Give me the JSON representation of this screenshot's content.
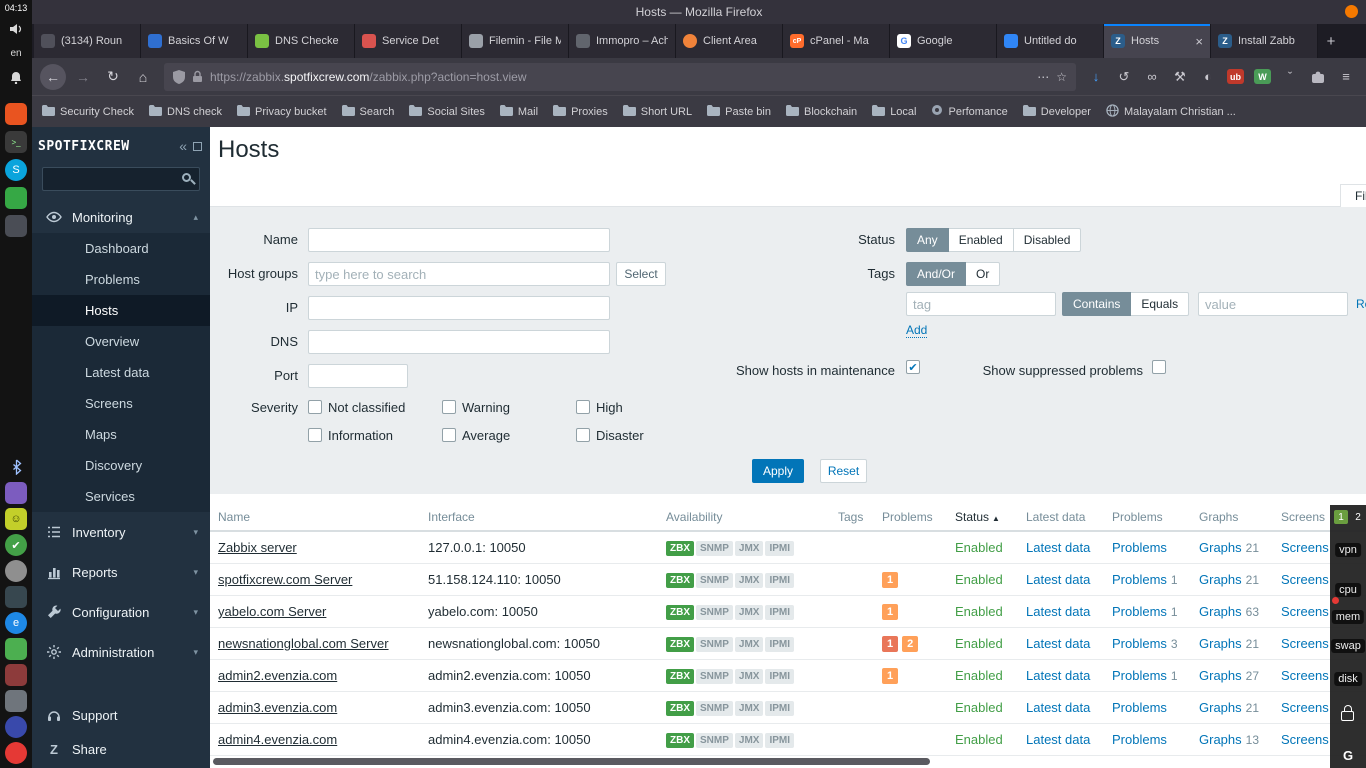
{
  "icons": {
    "back": "←",
    "forward": "→",
    "reload": "↻",
    "home": "⌂",
    "overflow": "⋯",
    "star": "☆",
    "download": "↓",
    "history": "↺",
    "infinity": "∞",
    "wrench": "⚒",
    "moon": "◐",
    "chevron_down": "ˇ",
    "menu": "≡",
    "new_tab": "+",
    "close": "×",
    "collapse": "«",
    "sort_asc": "▲",
    "chevron_expanded": "▴",
    "chevron_collapsed": "▾",
    "check": "✔"
  },
  "colors": {
    "accent_blue": "#0275b8",
    "status_green": "#429e47",
    "severity_average": "#ffa059",
    "severity_high": "#e97659",
    "segment_selected": "#768d99"
  },
  "os_panel": {
    "time": "04:13",
    "keyboard_layout": "en",
    "app_icons": [
      {
        "name": "orange-app-icon",
        "color": "#e95420",
        "glyph": "",
        "shape": "square"
      },
      {
        "name": "terminal-app-icon",
        "color": "#3a3a3a",
        "glyph": ">_",
        "shape": "square"
      },
      {
        "name": "skype-app-icon",
        "color": "#0aa4dc",
        "glyph": "S",
        "shape": "circle"
      },
      {
        "name": "green-app-icon",
        "color": "#36a845",
        "glyph": "",
        "shape": "square"
      },
      {
        "name": "slate-app-icon",
        "color": "#4a4d55",
        "glyph": "",
        "shape": "square"
      }
    ],
    "tray_icons": [
      {
        "name": "bluetooth-icon",
        "color": "transparent",
        "glyph": "bt",
        "shape": "square"
      },
      {
        "name": "purple-app-icon",
        "color": "#7c5cbf",
        "glyph": "",
        "shape": "square"
      },
      {
        "name": "smiley-app-icon",
        "color": "#c3cf2a",
        "glyph": "☺",
        "shape": "square"
      },
      {
        "name": "check-app-icon",
        "color": "#43a047",
        "glyph": "✔",
        "shape": "circle"
      },
      {
        "name": "gray-dot-icon",
        "color": "#8f8f8f",
        "glyph": "",
        "shape": "circle"
      },
      {
        "name": "dark-app-icon",
        "color": "#37474f",
        "glyph": "",
        "shape": "square"
      },
      {
        "name": "blue-e-app-icon",
        "color": "#1e88e5",
        "glyph": "e",
        "shape": "circle"
      },
      {
        "name": "green-app-icon-2",
        "color": "#4caf50",
        "glyph": "",
        "shape": "square"
      },
      {
        "name": "maroon-app-icon",
        "color": "#8d3b3b",
        "glyph": "",
        "shape": "square"
      },
      {
        "name": "gray-app-icon",
        "color": "#6f757c",
        "glyph": "",
        "shape": "square"
      },
      {
        "name": "indigo-app-icon",
        "color": "#3949ab",
        "glyph": "",
        "shape": "circle"
      },
      {
        "name": "red-app-icon",
        "color": "#e53935",
        "glyph": "",
        "shape": "circle"
      }
    ]
  },
  "right_overlay": {
    "workspaces": [
      {
        "label": "1",
        "active": true
      },
      {
        "label": "2",
        "active": false
      }
    ],
    "monitor_labels": [
      "vpn",
      "cpu",
      "mem",
      "swap",
      "disk"
    ],
    "bottom_letter": "G"
  },
  "browser": {
    "window_title": "Hosts — Mozilla Firefox",
    "tabs": [
      {
        "label": "(3134) Roun",
        "icon": "globe-dark",
        "active": false
      },
      {
        "label": "Basics Of W",
        "icon": "blue-square",
        "active": false
      },
      {
        "label": "DNS Checke",
        "icon": "shield-green",
        "active": false
      },
      {
        "label": "Service Det",
        "icon": "red-square",
        "active": false
      },
      {
        "label": "Filemin - File M",
        "icon": "gray-file",
        "active": false
      },
      {
        "label": "Immopro – Ach",
        "icon": "dark-square",
        "active": false
      },
      {
        "label": "Client Area",
        "icon": "orange-round",
        "active": false
      },
      {
        "label": "cPanel - Ma",
        "icon": "cpanel-orange",
        "active": false
      },
      {
        "label": "Google",
        "icon": "google-g",
        "active": false
      },
      {
        "label": "Untitled do",
        "icon": "doc-blue",
        "active": false
      },
      {
        "label": "Hosts",
        "icon": "zabbix-z",
        "active": true
      },
      {
        "label": "Install Zabb",
        "icon": "zabbix-z",
        "active": false
      }
    ],
    "urlbar": {
      "url_prefix": "https://zabbix.",
      "url_domain": "spotfixcrew.com",
      "url_path": "/zabbix.php?action=host.view"
    },
    "toolbar_badges": {
      "ublock": "ub",
      "wappalyzer": "W"
    },
    "bookmarks": [
      {
        "label": "Security Check",
        "icon": "folder"
      },
      {
        "label": "DNS check",
        "icon": "folder"
      },
      {
        "label": "Privacy bucket",
        "icon": "folder"
      },
      {
        "label": "Search",
        "icon": "folder"
      },
      {
        "label": "Social Sites",
        "icon": "folder"
      },
      {
        "label": "Mail",
        "icon": "folder"
      },
      {
        "label": "Proxies",
        "icon": "folder"
      },
      {
        "label": "Short URL",
        "icon": "folder"
      },
      {
        "label": "Paste bin",
        "icon": "folder"
      },
      {
        "label": "Blockchain",
        "icon": "folder"
      },
      {
        "label": "Local",
        "icon": "folder"
      },
      {
        "label": "Perfomance",
        "icon": "site"
      },
      {
        "label": "Developer",
        "icon": "folder"
      },
      {
        "label": "Malayalam Christian ...",
        "icon": "globe"
      }
    ]
  },
  "zabbix": {
    "logo": "SPOTFIXCREW",
    "menu": [
      {
        "label": "Monitoring",
        "icon": "eye",
        "expanded": true,
        "children": [
          "Dashboard",
          "Problems",
          "Hosts",
          "Overview",
          "Latest data",
          "Screens",
          "Maps",
          "Discovery",
          "Services"
        ],
        "selected_child": "Hosts"
      },
      {
        "label": "Inventory",
        "icon": "list",
        "expanded": false
      },
      {
        "label": "Reports",
        "icon": "chart",
        "expanded": false
      },
      {
        "label": "Configuration",
        "icon": "wrench",
        "expanded": false
      },
      {
        "label": "Administration",
        "icon": "gear",
        "expanded": false
      }
    ],
    "menu_footer": [
      {
        "label": "Support",
        "icon": "headset"
      },
      {
        "label": "Share",
        "icon": "zabbix"
      }
    ],
    "page_title": "Hosts",
    "filter_tab": "Filter",
    "filter": {
      "name_label": "Name",
      "host_groups_label": "Host groups",
      "host_groups_placeholder": "type here to search",
      "select_button": "Select",
      "ip_label": "IP",
      "dns_label": "DNS",
      "port_label": "Port",
      "severity_label": "Severity",
      "severity_options": [
        "Not classified",
        "Information",
        "Warning",
        "Average",
        "High",
        "Disaster"
      ],
      "status_label": "Status",
      "status_options": [
        "Any",
        "Enabled",
        "Disabled"
      ],
      "status_selected": "Any",
      "tags_label": "Tags",
      "tags_options": [
        "And/Or",
        "Or"
      ],
      "tags_selected": "And/Or",
      "tag_placeholder": "tag",
      "match_options": [
        "Contains",
        "Equals"
      ],
      "match_selected": "Contains",
      "value_placeholder": "value",
      "remove_label": "Remove",
      "add_label": "Add",
      "maintenance_label": "Show hosts in maintenance",
      "maintenance_checked": true,
      "suppressed_label": "Show suppressed problems",
      "suppressed_checked": false,
      "apply_label": "Apply",
      "reset_label": "Reset"
    },
    "table": {
      "columns": [
        "Name",
        "Interface",
        "Availability",
        "Tags",
        "Problems",
        "Status",
        "Latest data",
        "Problems",
        "Graphs",
        "Screens"
      ],
      "sort_column": "Status",
      "availability_types": [
        "ZBX",
        "SNMP",
        "JMX",
        "IPMI"
      ],
      "rows": [
        {
          "name": "Zabbix server",
          "interface": "127.0.0.1: 10050",
          "problem_badges": [],
          "status": "Enabled",
          "latest_data": "Latest data",
          "problems": "Problems",
          "problems_count": "",
          "graphs": "Graphs",
          "graphs_count": "21",
          "screens": "Screens"
        },
        {
          "name": "spotfixcrew.com Server",
          "interface": "51.158.124.110: 10050",
          "problem_badges": [
            {
              "count": "1",
              "color": "#ffa059"
            }
          ],
          "status": "Enabled",
          "latest_data": "Latest data",
          "problems": "Problems",
          "problems_count": "1",
          "graphs": "Graphs",
          "graphs_count": "21",
          "screens": "Screens"
        },
        {
          "name": "yabelo.com Server",
          "interface": "yabelo.com: 10050",
          "problem_badges": [
            {
              "count": "1",
              "color": "#ffa059"
            }
          ],
          "status": "Enabled",
          "latest_data": "Latest data",
          "problems": "Problems",
          "problems_count": "1",
          "graphs": "Graphs",
          "graphs_count": "63",
          "screens": "Screens"
        },
        {
          "name": "newsnationglobal.com Server",
          "interface": "newsnationglobal.com: 10050",
          "problem_badges": [
            {
              "count": "1",
              "color": "#e97659"
            },
            {
              "count": "2",
              "color": "#ffa059"
            }
          ],
          "status": "Enabled",
          "latest_data": "Latest data",
          "problems": "Problems",
          "problems_count": "3",
          "graphs": "Graphs",
          "graphs_count": "21",
          "screens": "Screens"
        },
        {
          "name": "admin2.evenzia.com",
          "interface": "admin2.evenzia.com: 10050",
          "problem_badges": [
            {
              "count": "1",
              "color": "#ffa059"
            }
          ],
          "status": "Enabled",
          "latest_data": "Latest data",
          "problems": "Problems",
          "problems_count": "1",
          "graphs": "Graphs",
          "graphs_count": "27",
          "screens": "Screens"
        },
        {
          "name": "admin3.evenzia.com",
          "interface": "admin3.evenzia.com: 10050",
          "problem_badges": [],
          "status": "Enabled",
          "latest_data": "Latest data",
          "problems": "Problems",
          "problems_count": "",
          "graphs": "Graphs",
          "graphs_count": "21",
          "screens": "Screens"
        },
        {
          "name": "admin4.evenzia.com",
          "interface": "admin4.evenzia.com: 10050",
          "problem_badges": [],
          "status": "Enabled",
          "latest_data": "Latest data",
          "problems": "Problems",
          "problems_count": "",
          "graphs": "Graphs",
          "graphs_count": "13",
          "screens": "Screens"
        }
      ]
    }
  }
}
